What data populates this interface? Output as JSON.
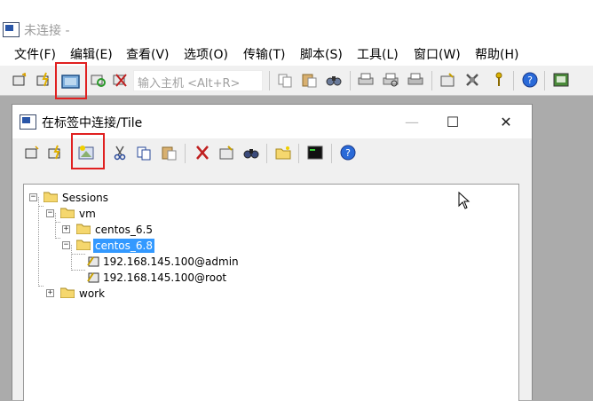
{
  "window": {
    "title": "未连接 -"
  },
  "menu": [
    "文件(F)",
    "编辑(E)",
    "查看(V)",
    "选项(O)",
    "传输(T)",
    "脚本(S)",
    "工具(L)",
    "窗口(W)",
    "帮助(H)"
  ],
  "toolbar": {
    "host_placeholder": "输入主机 <Alt+R>",
    "icons": [
      "connect-icon",
      "quick-connect-icon",
      "connect-in-tab-icon",
      "reconnect-icon",
      "disconnect-icon",
      "copy-icon",
      "paste-icon",
      "find-icon",
      "print-setup-icon",
      "print-preview-icon",
      "print-icon",
      "session-options-icon",
      "global-options-icon",
      "key-icon",
      "help-icon",
      "sftp-icon"
    ]
  },
  "dialog": {
    "title": "在标签中连接/Tile",
    "buttons": {
      "minimize": "—",
      "maximize": "☐",
      "close": "✕"
    },
    "toolbar_icons": [
      "connect-icon",
      "quick-connect-icon",
      "new-session-icon",
      "cut-icon",
      "copy-icon",
      "paste-icon",
      "delete-icon",
      "properties-icon",
      "find-icon",
      "new-folder-icon",
      "terminal-icon",
      "help-icon"
    ]
  },
  "tree": {
    "root": "Sessions",
    "vm": "vm",
    "centos65": "centos_6.5",
    "centos68": "centos_6.8",
    "session_admin": "192.168.145.100@admin",
    "session_root": "192.168.145.100@root",
    "work": "work",
    "selected": "centos_6.8"
  },
  "colors": {
    "highlight": "#3399ff",
    "annotation": "#e02020",
    "folder": "#f5d76e"
  }
}
